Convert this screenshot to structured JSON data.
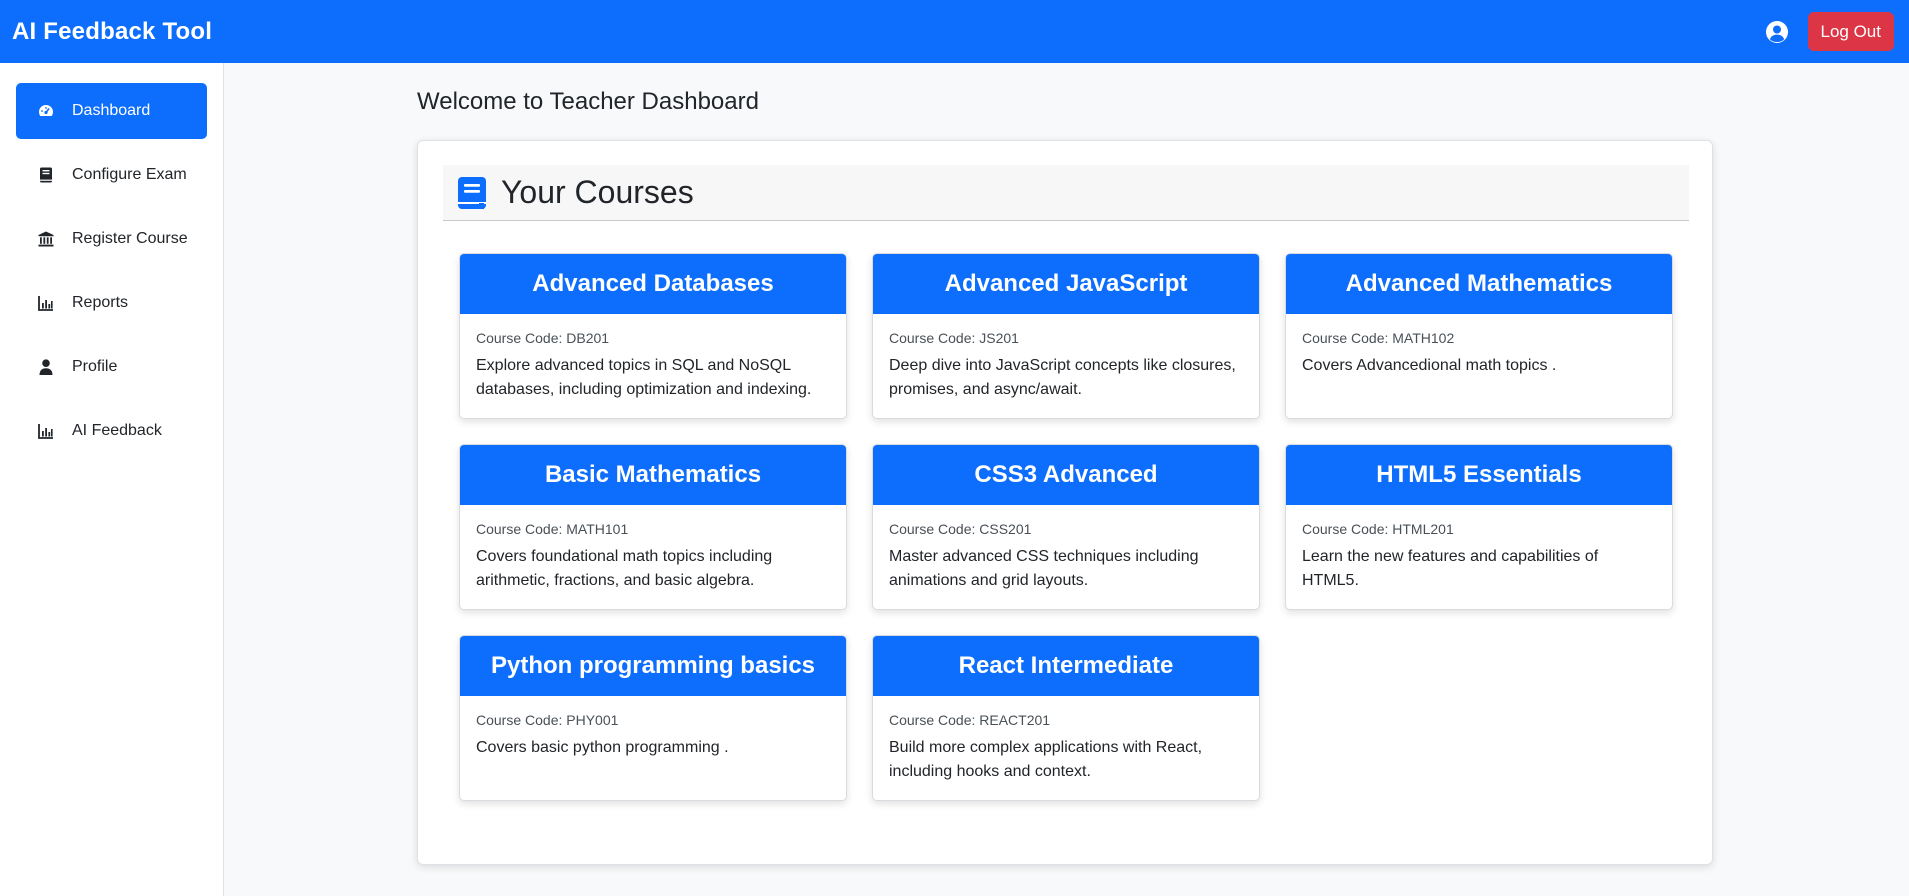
{
  "header": {
    "brand": "AI Feedback Tool",
    "logout_label": "Log Out"
  },
  "sidebar": {
    "items": [
      {
        "label": "Dashboard",
        "icon": "gauge-icon",
        "active": true
      },
      {
        "label": "Configure Exam",
        "icon": "book-icon"
      },
      {
        "label": "Register Course",
        "icon": "institution-icon"
      },
      {
        "label": "Reports",
        "icon": "chart-bar-icon"
      },
      {
        "label": "Profile",
        "icon": "user-icon"
      },
      {
        "label": "AI Feedback",
        "icon": "chart-bar-icon"
      }
    ]
  },
  "main": {
    "title": "Welcome to Teacher Dashboard",
    "courses_title": "Your Courses",
    "courses": [
      {
        "name": "Advanced Databases",
        "code": "Course Code: DB201",
        "description": "Explore advanced topics in SQL and NoSQL databases, including optimization and indexing."
      },
      {
        "name": "Advanced JavaScript",
        "code": "Course Code: JS201",
        "description": "Deep dive into JavaScript concepts like closures, promises, and async/await."
      },
      {
        "name": "Advanced Mathematics",
        "code": "Course Code: MATH102",
        "description": "Covers Advancedional math topics ."
      },
      {
        "name": "Basic Mathematics",
        "code": "Course Code: MATH101",
        "description": "Covers foundational math topics including arithmetic, fractions, and basic algebra."
      },
      {
        "name": "CSS3 Advanced",
        "code": "Course Code: CSS201",
        "description": "Master advanced CSS techniques including animations and grid layouts."
      },
      {
        "name": "HTML5 Essentials",
        "code": "Course Code: HTML201",
        "description": "Learn the new features and capabilities of HTML5."
      },
      {
        "name": "Python programming basics",
        "code": "Course Code: PHY001",
        "description": "Covers basic python programming ."
      },
      {
        "name": "React Intermediate",
        "code": "Course Code: REACT201",
        "description": "Build more complex applications with React, including hooks and context."
      }
    ]
  },
  "colors": {
    "primary": "#0d6efd",
    "danger": "#dc3545"
  }
}
